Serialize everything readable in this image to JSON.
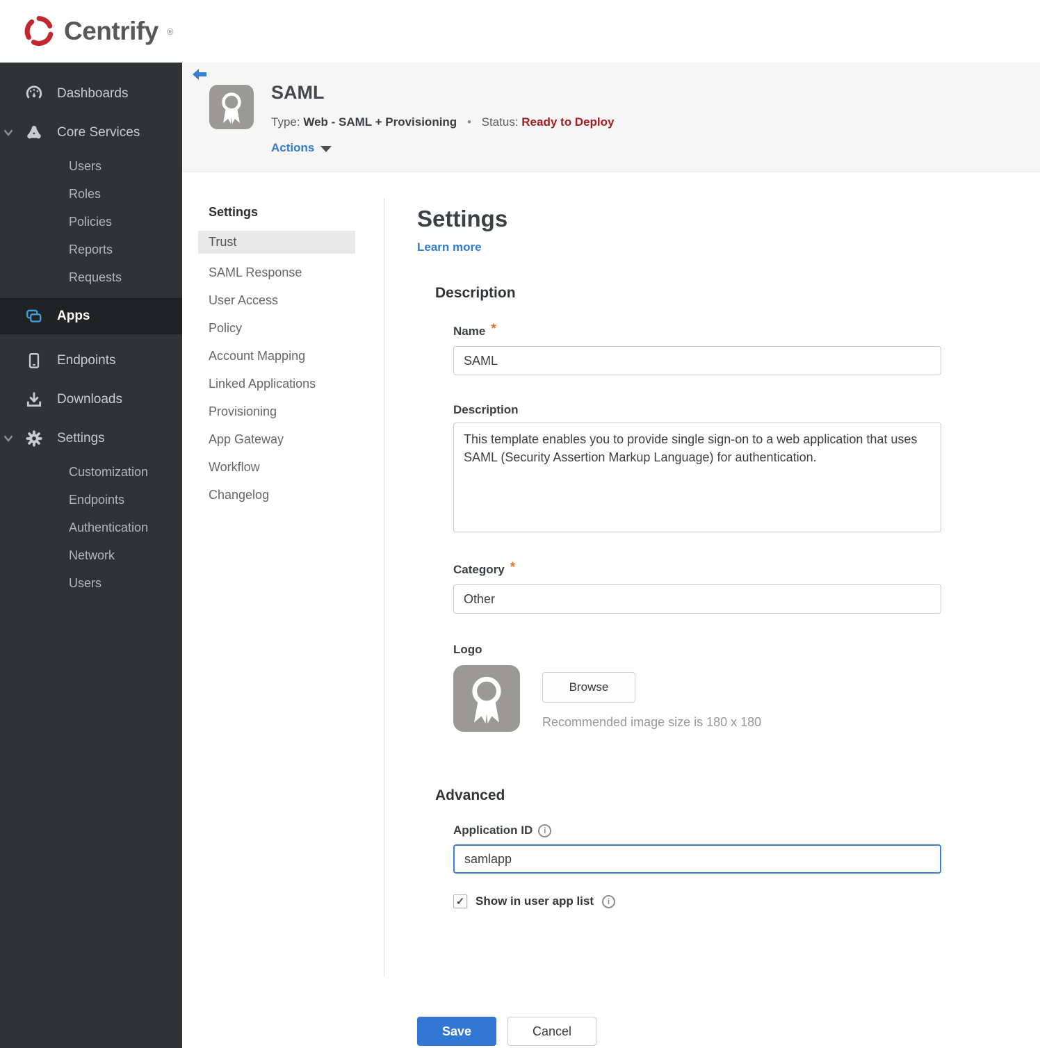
{
  "colors": {
    "brand_red": "#c1272d",
    "accent_blue": "#3377d4",
    "link_blue": "#2e7cd6",
    "status_red": "#a31d22",
    "apps_icon_blue": "#3d9fd9",
    "required_orange": "#e7722a",
    "focus_border_blue": "#3b7ed6",
    "sidebar_bg": "#303335",
    "sidebar_selected_bg": "#202224"
  },
  "brand": {
    "name": "Centrify",
    "registered": "®",
    "icon": "centrify-swirl-icon"
  },
  "sidebar": {
    "items": [
      {
        "label": "Dashboards",
        "icon": "gauge-icon",
        "level": 1
      },
      {
        "label": "Core Services",
        "icon": "core-services-icon",
        "level": 1,
        "expanded": true
      },
      {
        "label": "Users",
        "level": 2
      },
      {
        "label": "Roles",
        "level": 2
      },
      {
        "label": "Policies",
        "level": 2
      },
      {
        "label": "Reports",
        "level": 2
      },
      {
        "label": "Requests",
        "level": 2
      },
      {
        "label": "Apps",
        "icon": "apps-icon",
        "level": 1,
        "selected": true
      },
      {
        "label": "Endpoints",
        "icon": "smartphone-icon",
        "level": 1
      },
      {
        "label": "Downloads",
        "icon": "download-icon",
        "level": 1
      },
      {
        "label": "Settings",
        "icon": "gear-icon",
        "level": 1,
        "expanded": true
      },
      {
        "label": "Customization",
        "level": 2
      },
      {
        "label": "Endpoints",
        "level": 2
      },
      {
        "label": "Authentication",
        "level": 2
      },
      {
        "label": "Network",
        "level": 2
      },
      {
        "label": "Users",
        "level": 2
      }
    ]
  },
  "app_header": {
    "title": "SAML",
    "app_icon": "award-ribbon-icon",
    "type_label": "Type:",
    "type_value": "Web - SAML + Provisioning",
    "separator": "•",
    "status_label": "Status:",
    "status_value": "Ready to Deploy",
    "actions_label": "Actions"
  },
  "subnav": {
    "header": "Settings",
    "items": [
      {
        "label": "Trust",
        "selected": true
      },
      {
        "label": "SAML Response"
      },
      {
        "label": "User Access"
      },
      {
        "label": "Policy"
      },
      {
        "label": "Account Mapping"
      },
      {
        "label": "Linked Applications"
      },
      {
        "label": "Provisioning"
      },
      {
        "label": "App Gateway"
      },
      {
        "label": "Workflow"
      },
      {
        "label": "Changelog"
      }
    ]
  },
  "form": {
    "title": "Settings",
    "learn_more_label": "Learn more",
    "required_marker": "*",
    "description": {
      "heading": "Description",
      "name_label": "Name",
      "name_value": "SAML",
      "description_label": "Description",
      "description_value": "This template enables you to provide single sign-on to a web application that uses SAML (Security Assertion Markup Language) for authentication.",
      "category_label": "Category",
      "category_value": "Other",
      "logo_label": "Logo",
      "logo_icon": "award-ribbon-icon",
      "browse_label": "Browse",
      "logo_hint": "Recommended image size is 180 x 180"
    },
    "advanced": {
      "heading": "Advanced",
      "app_id_label": "Application ID",
      "app_id_value": "samlapp",
      "show_in_app_list_label": "Show in user app list",
      "show_in_app_list_checked": true
    },
    "actions": {
      "save_label": "Save",
      "cancel_label": "Cancel"
    }
  }
}
